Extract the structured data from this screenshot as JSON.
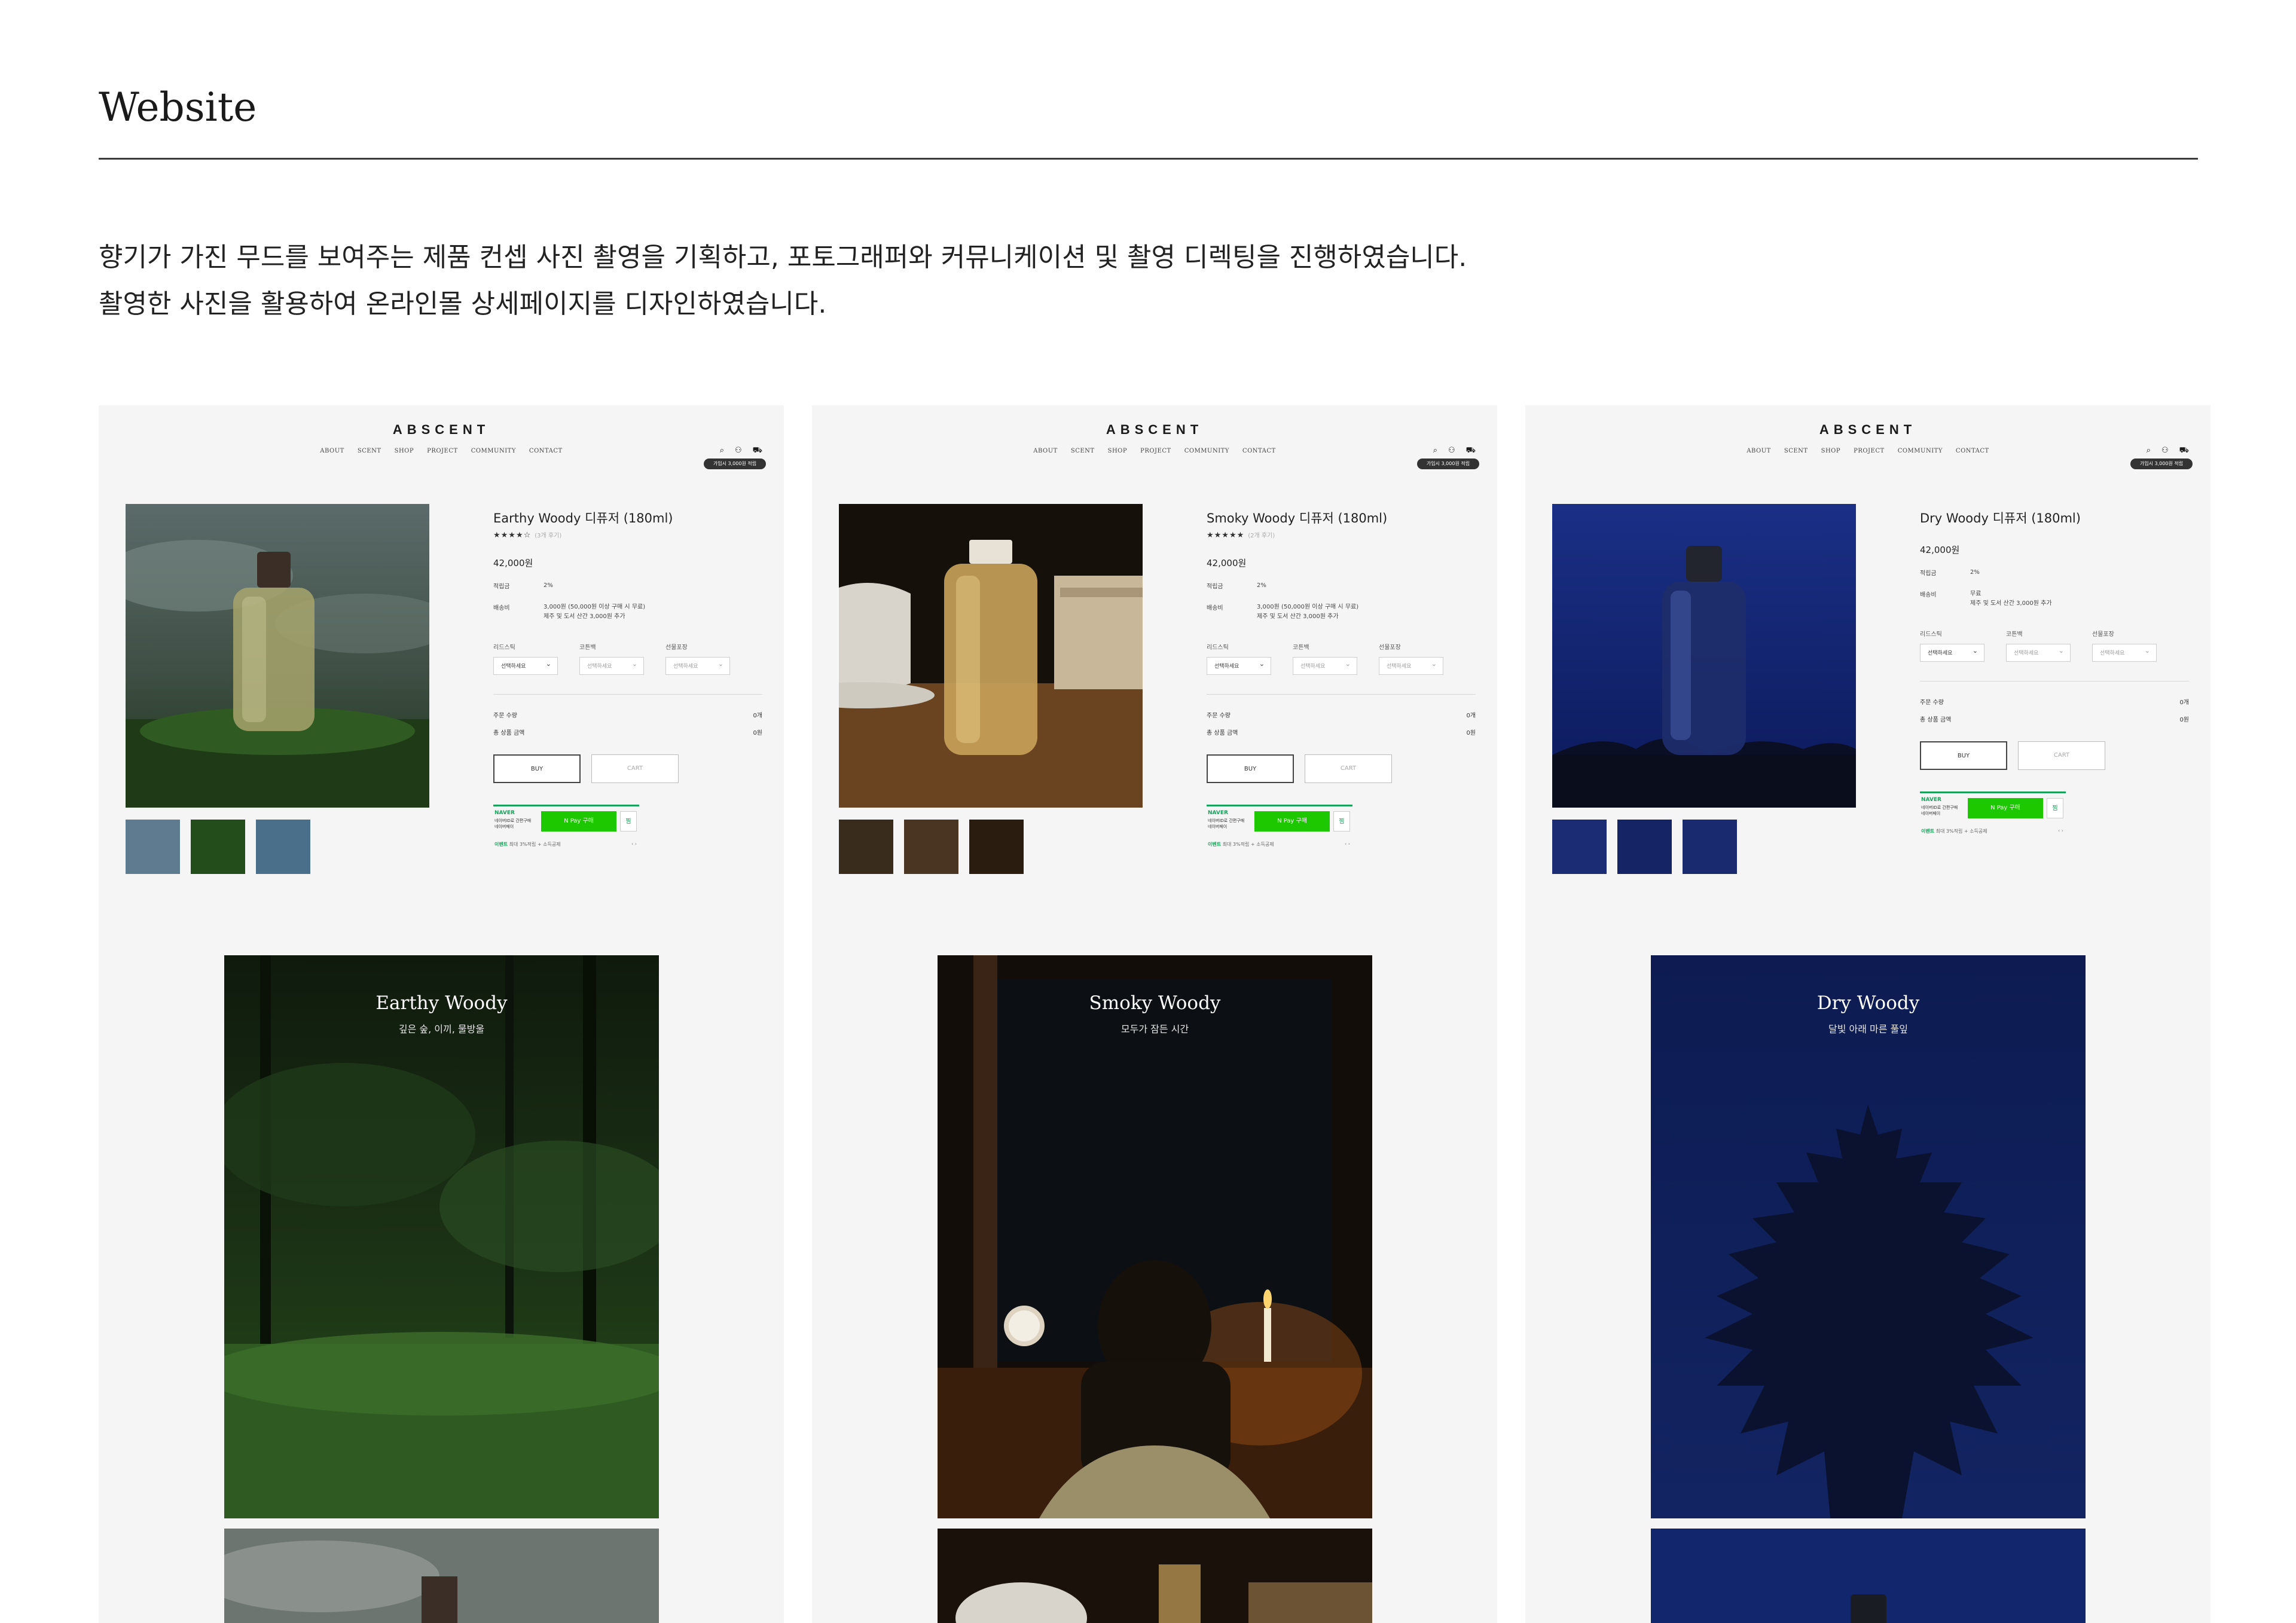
{
  "page": {
    "title": "Website",
    "description": [
      "향기가 가진 무드를 보여주는 제품 컨셉 사진 촬영을 기획하고, 포토그래퍼와 커뮤니케이션 및 촬영 디렉팅을 진행하였습니다.",
      "촬영한 사진을 활용하여 온라인몰 상세페이지를 디자인하였습니다."
    ]
  },
  "site": {
    "brand": "ABSCENT",
    "nav": [
      "ABOUT",
      "SCENT",
      "SHOP",
      "PROJECT",
      "COMMUNITY",
      "CONTACT"
    ],
    "coupon": "가입시 3,000원 적립",
    "icons": [
      "search-icon",
      "user-icon",
      "cart-icon"
    ]
  },
  "labels": {
    "points": "적립금",
    "shipping": "배송비",
    "opt1": "리드스틱",
    "opt2": "코튼백",
    "opt3": "선물포장",
    "select": "선택하세요",
    "qty": "주문 수량",
    "total": "총 상품 금액",
    "qty_val": "0개",
    "total_val": "0원",
    "buy": "BUY",
    "cart": "CART",
    "naver": "NAVER",
    "naver_sub": "네이버ID로 간편구매\n네이버페이",
    "pay": "N Pay 구매",
    "heart": "찜",
    "event": "이벤트",
    "event_sub": "최대 3%적립 + 소득공제"
  },
  "products": [
    {
      "name": "Earthy Woody 디퓨저 (180ml)",
      "rating": "★★★★☆",
      "reviews": "(3개 후기)",
      "price": "42,000원",
      "points": "2%",
      "shipping": "3,000원 (50,000원 이상 구매 시 무료)\n제주 및 도서 산간 3,000원 추가",
      "hero_title": "Earthy Woody",
      "hero_sub": "깊은 숲, 이끼, 물방울",
      "theme": "earthy"
    },
    {
      "name": "Smoky Woody 디퓨저 (180ml)",
      "rating": "★★★★★",
      "reviews": "(2개 후기)",
      "price": "42,000원",
      "points": "2%",
      "shipping": "3,000원 (50,000원 이상 구매 시 무료)\n제주 및 도서 산간 3,000원 추가",
      "hero_title": "Smoky Woody",
      "hero_sub": "모두가 잠든 시간",
      "theme": "smoky"
    },
    {
      "name": "Dry Woody 디퓨저 (180ml)",
      "rating": "",
      "reviews": "",
      "price": "42,000원",
      "points": "2%",
      "shipping": "무료\n제주 및 도서 산간 3,000원 추가",
      "hero_title": "Dry Woody",
      "hero_sub": "달빛 아래 마른 풀잎",
      "theme": "dry"
    }
  ],
  "colors": {
    "panel_bg": "#f5f5f5",
    "naver_green": "#1ec800",
    "earthy": "#1f3a1a",
    "smoky": "#1a120a",
    "dry": "#0e1c4e"
  }
}
